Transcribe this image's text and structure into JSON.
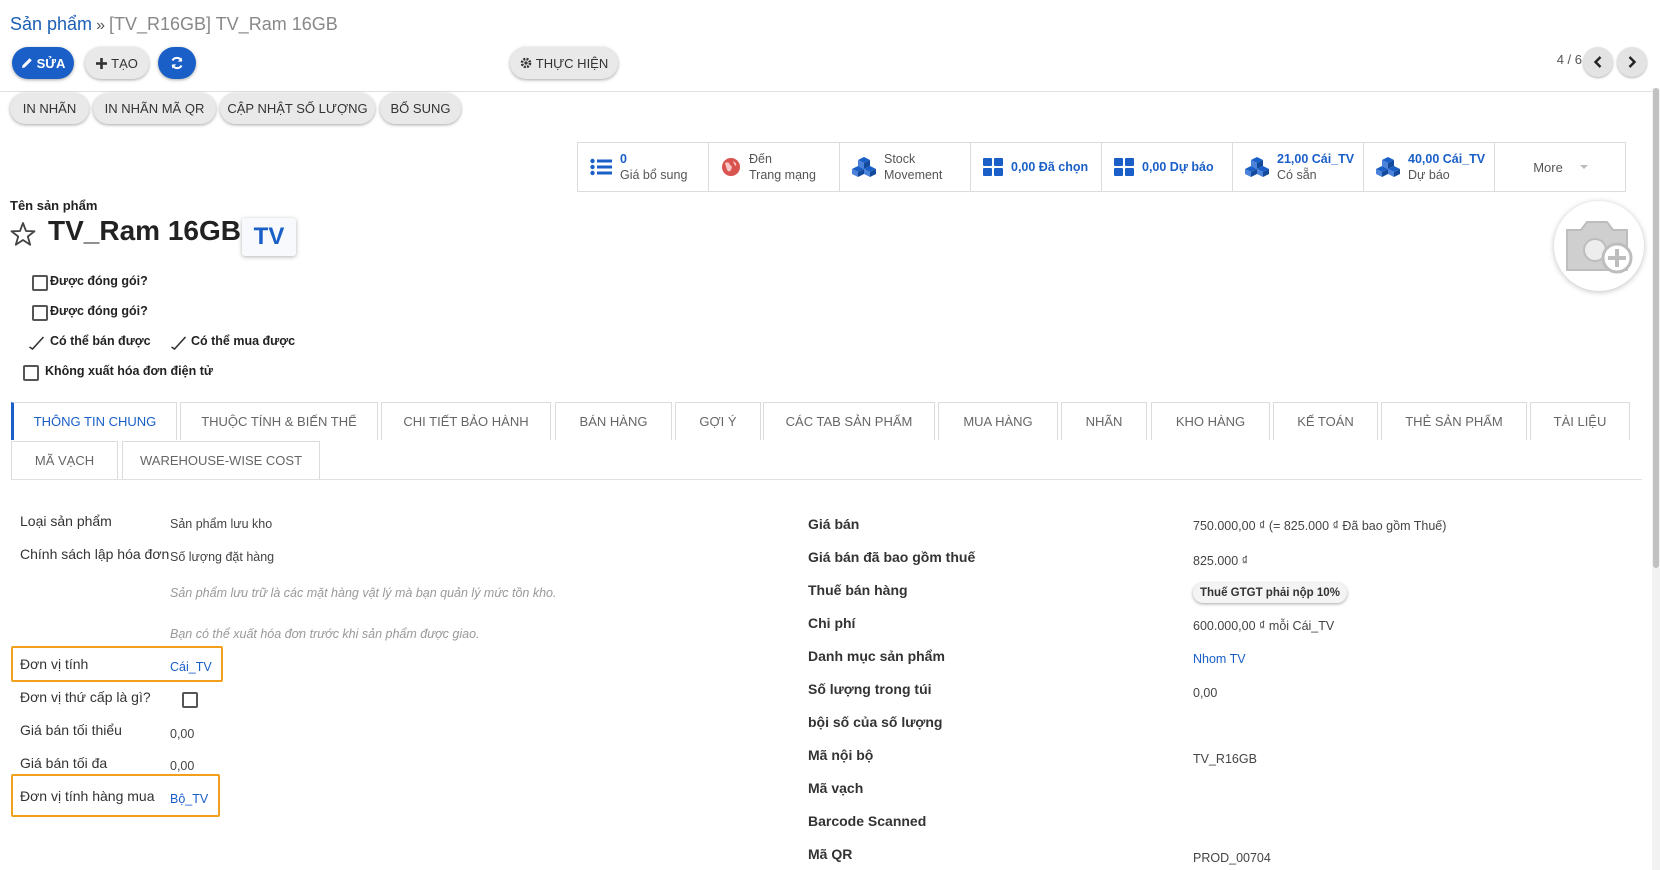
{
  "breadcrumb": {
    "parent": "Sản phẩm",
    "separator": "»",
    "current": "[TV_R16GB] TV_Ram 16GB"
  },
  "toolbar": {
    "edit_label": "SỬA",
    "create_label": "TẠO",
    "execute_label": "THỰC HIỆN"
  },
  "pager": {
    "text": "4 / 6"
  },
  "actions": [
    "IN NHÃN",
    "IN NHÃN MÃ QR",
    "CẬP NHẬT SỐ LƯỢNG",
    "BỔ SUNG"
  ],
  "smart_buttons": {
    "extra_price": {
      "value": "0",
      "label": "Giá bổ sung"
    },
    "website": {
      "value": "Đến",
      "label": "Trang mạng"
    },
    "stock_movement": {
      "value": "Stock",
      "label": "Movement"
    },
    "selected": {
      "text": "0,00 Đã chọn"
    },
    "forecast": {
      "text": "0,00 Dự báo"
    },
    "on_hand": {
      "value": "21,00 Cái_TV",
      "label": "Có sẵn"
    },
    "forecasted": {
      "value": "40,00 Cái_TV",
      "label": "Dự báo"
    },
    "more": "More"
  },
  "product": {
    "name_caption": "Tên sản phẩm",
    "name": "TV_Ram 16GB",
    "badge": "TV"
  },
  "options": {
    "packaging_1": "Được đóng gói?",
    "packaging_2": "Được đóng gói?",
    "can_sell": "Có thể bán được",
    "can_purchase": "Có thể mua được",
    "no_einvoice": "Không xuất hóa đơn điện tử"
  },
  "tabs": [
    "THÔNG TIN CHUNG",
    "THUỘC TÍNH & BIẾN THỂ",
    "CHI TIẾT BẢO HÀNH",
    "BÁN HÀNG",
    "GỢI Ý",
    "CÁC TAB SẢN PHẨM",
    "MUA HÀNG",
    "NHÃN",
    "KHO HÀNG",
    "KẾ TOÁN",
    "THẺ SẢN PHẨM",
    "TÀI LIỆU",
    "MÃ VẠCH",
    "WAREHOUSE-WISE COST"
  ],
  "left_form": {
    "product_type_label": "Loại sản phẩm",
    "product_type_value": "Sản phẩm lưu kho",
    "invoice_policy_label": "Chính sách lập hóa đơn",
    "invoice_policy_value": "Số lượng đặt hàng",
    "hint_1": "Sản phẩm lưu trữ là các mặt hàng vật lý mà bạn quản lý mức tồn kho.",
    "hint_2": "Bạn có thể xuất hóa đơn trước khi sản phẩm được giao.",
    "uom_label": "Đơn vị tính",
    "uom_value": "Cái_TV",
    "secondary_uom_label": "Đơn vị thứ cấp là gì?",
    "min_price_label": "Giá bán tối thiểu",
    "min_price_value": "0,00",
    "max_price_label": "Giá bán tối đa",
    "max_price_value": "0,00",
    "purchase_uom_label": "Đơn vị tính hàng mua",
    "purchase_uom_value": "Bộ_TV"
  },
  "right_form": {
    "sale_price_label": "Giá bán",
    "sale_price_value": "750.000,00 ₫  (= 825.000 ₫ Đã bao gồm Thuế)",
    "price_incl_tax_label": "Giá bán đã bao gồm thuế",
    "price_incl_tax_value": "825.000 ₫",
    "sales_tax_label": "Thuế bán hàng",
    "sales_tax_tag": "Thuế GTGT phải nộp 10%",
    "cost_label": "Chi phí",
    "cost_value": "600.000,00 ₫ mỗi Cái_TV",
    "category_label": "Danh mục sản phẩm",
    "category_value": "Nhom TV",
    "qty_per_bag_label": "Số lượng trong túi",
    "qty_per_bag_value": "0,00",
    "qty_multiple_label": "bội số của số lượng",
    "internal_ref_label": "Mã nội bộ",
    "internal_ref_value": "TV_R16GB",
    "barcode_label": "Mã vạch",
    "barcode_scanned_label": "Barcode Scanned",
    "qr_label": "Mã QR",
    "qr_value": "PROD_00704"
  }
}
